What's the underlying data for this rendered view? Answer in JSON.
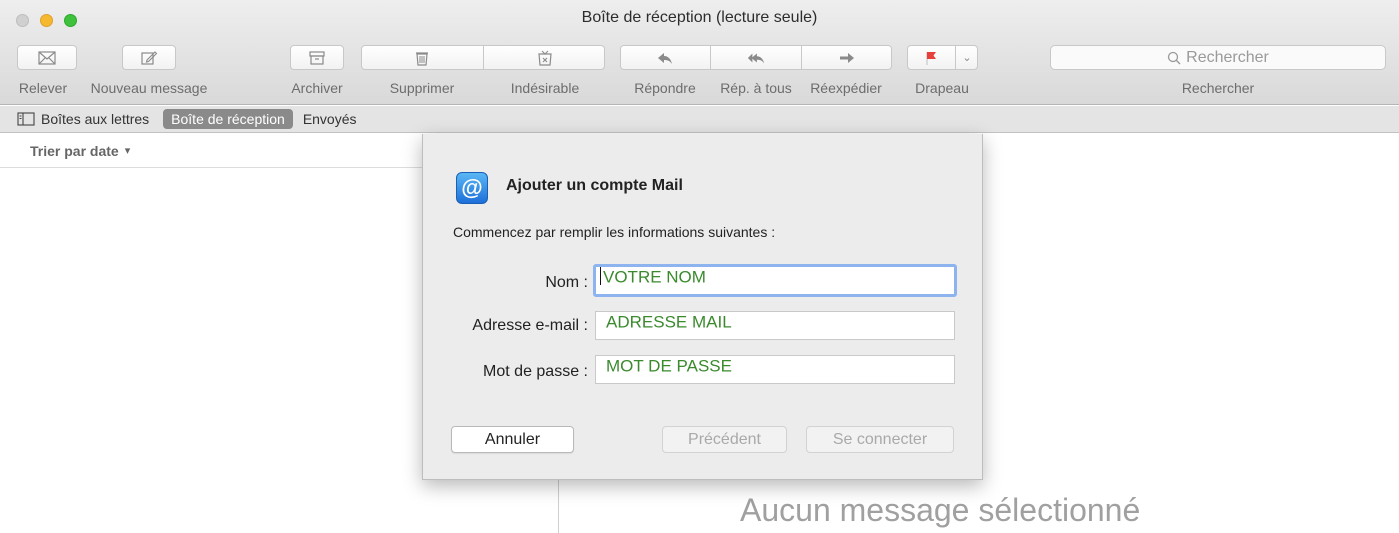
{
  "window": {
    "title": "Boîte de réception (lecture seule)"
  },
  "toolbar": {
    "get_mail": "Relever",
    "new_message": "Nouveau message",
    "archive": "Archiver",
    "delete": "Supprimer",
    "junk": "Indésirable",
    "reply": "Répondre",
    "reply_all": "Rép. à tous",
    "forward": "Réexpédier",
    "flag": "Drapeau",
    "search_placeholder": "Rechercher",
    "search_label": "Rechercher"
  },
  "favorites_bar": {
    "mailboxes": "Boîtes aux lettres",
    "inbox": "Boîte de réception",
    "sent": "Envoyés"
  },
  "message_list": {
    "sort_label": "Trier par date"
  },
  "viewer": {
    "empty_text": "Aucun message sélectionné"
  },
  "sheet": {
    "title": "Ajouter un compte Mail",
    "intro": "Commencez par remplir les informations suivantes :",
    "fields": {
      "name_label": "Nom :",
      "name_value": "VOTRE NOM",
      "email_label": "Adresse e-mail :",
      "email_value": "ADRESSE MAIL",
      "password_label": "Mot de passe :",
      "password_value": "MOT DE PASSE"
    },
    "buttons": {
      "cancel": "Annuler",
      "previous": "Précédent",
      "sign_in": "Se connecter"
    }
  },
  "colors": {
    "field_text": "#3a8a2d",
    "accent": "#1d6fd8",
    "flag": "#e8403c",
    "selected_tab": "#8a8a8a"
  },
  "icons": {
    "get_mail": "envelope-icon",
    "new_message": "compose-icon",
    "archive": "archive-box-icon",
    "delete": "trash-icon",
    "junk": "junk-bin-icon",
    "reply": "reply-arrow-icon",
    "reply_all": "reply-all-arrow-icon",
    "forward": "forward-arrow-icon",
    "flag": "flag-icon",
    "search": "magnifier-icon",
    "mailboxes": "sidebar-icon",
    "account": "at-sign-icon"
  }
}
